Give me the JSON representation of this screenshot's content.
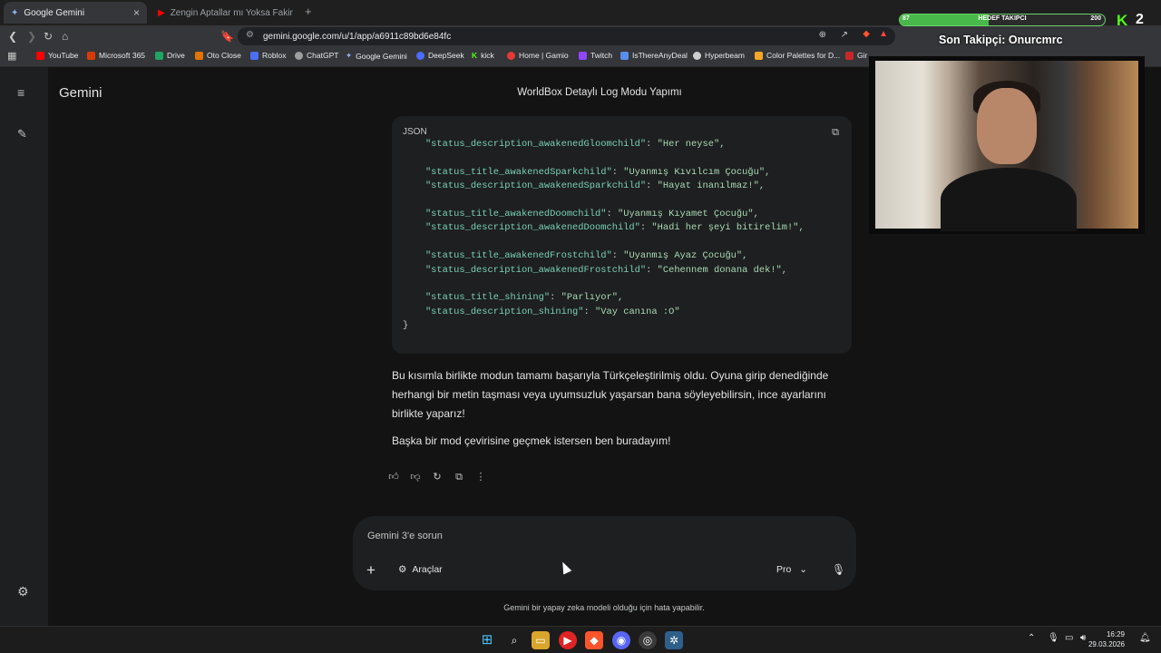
{
  "browser": {
    "tabs": [
      {
        "title": "Google Gemini",
        "active": true
      },
      {
        "title": "Zengin Aptallar mı Yoksa Fakir Dahile",
        "active": false
      }
    ],
    "new_tab_label": "+",
    "url": "gemini.google.com/u/1/app/a6911c89bd6e84fc",
    "bookmarks": [
      {
        "label": "YouTube",
        "color": "#ff0000"
      },
      {
        "label": "Microsoft 365",
        "color": "#d83b01"
      },
      {
        "label": "Drive",
        "color": "#1fa463"
      },
      {
        "label": "Oto Close",
        "color": "#e37400"
      },
      {
        "label": "Roblox",
        "color": "#4c6ef5"
      },
      {
        "label": "ChatGPT",
        "color": "#9e9e9e"
      },
      {
        "label": "Google Gemini",
        "color": "#8ab4f8"
      },
      {
        "label": "DeepSeek",
        "color": "#4d6bfe"
      },
      {
        "label": "kick",
        "color": "#53fc18"
      },
      {
        "label": "Home | Gamio",
        "color": "#e53935"
      },
      {
        "label": "Twitch",
        "color": "#9146ff"
      },
      {
        "label": "IsThereAnyDeal",
        "color": "#5b8def"
      },
      {
        "label": "Hyperbeam",
        "color": "#cfcfcf"
      },
      {
        "label": "Color Palettes for D...",
        "color": "#f9a825"
      },
      {
        "label": "Gir",
        "color": "#c62828"
      }
    ]
  },
  "gemini": {
    "brand": "Gemini",
    "conversation_title": "WorldBox Detaylı Log Modu Yapımı",
    "code": {
      "language": "JSON",
      "lines": [
        {
          "key": "\"status_description_awakenedGloomchild\"",
          "value": "\"Her neyse\","
        },
        {
          "key": "",
          "value": ""
        },
        {
          "key": "\"status_title_awakenedSparkchild\"",
          "value": "\"Uyanmış Kıvılcım Çocuğu\","
        },
        {
          "key": "\"status_description_awakenedSparkchild\"",
          "value": "\"Hayat inanılmaz!\","
        },
        {
          "key": "",
          "value": ""
        },
        {
          "key": "\"status_title_awakenedDoomchild\"",
          "value": "\"Uyanmış Kıyamet Çocuğu\","
        },
        {
          "key": "\"status_description_awakenedDoomchild\"",
          "value": "\"Hadi her şeyi bitirelim!\","
        },
        {
          "key": "",
          "value": ""
        },
        {
          "key": "\"status_title_awakenedFrostchild\"",
          "value": "\"Uyanmış Ayaz Çocuğu\","
        },
        {
          "key": "\"status_description_awakenedFrostchild\"",
          "value": "\"Cehennem donana dek!\","
        },
        {
          "key": "",
          "value": ""
        },
        {
          "key": "\"status_title_shining\"",
          "value": "\"Parlıyor\","
        },
        {
          "key": "\"status_description_shining\"",
          "value": "\"Vay canına :O\""
        }
      ],
      "closing": "}"
    },
    "answer": [
      "Bu kısımla birlikte modun tamamı başarıyla Türkçeleştirilmiş oldu. Oyuna girip denediğinde herhangi bir metin taşması veya uyumsuzluk yaşarsan bana söyleyebilirsin, ince ayarlarını birlikte yaparız!",
      "Başka bir mod çevirisine geçmek istersen ben buradayım!"
    ],
    "prompt": {
      "placeholder": "Gemini 3'e sorun",
      "tools_label": "Araçlar",
      "model_label": "Pro"
    },
    "disclaimer": "Gemini bir yapay zeka modeli olduğu için hata yapabilir."
  },
  "overlay": {
    "follow_goal": {
      "current": "87",
      "title": "HEDEF TAKIPCI",
      "max": "200",
      "progress": 0.435
    },
    "kick_logo": "K",
    "kick_count": "2",
    "last_follower": "Son Takipçi: Onurcmrc"
  },
  "taskbar": {
    "time": "16:29",
    "date": "29.03.2026"
  }
}
